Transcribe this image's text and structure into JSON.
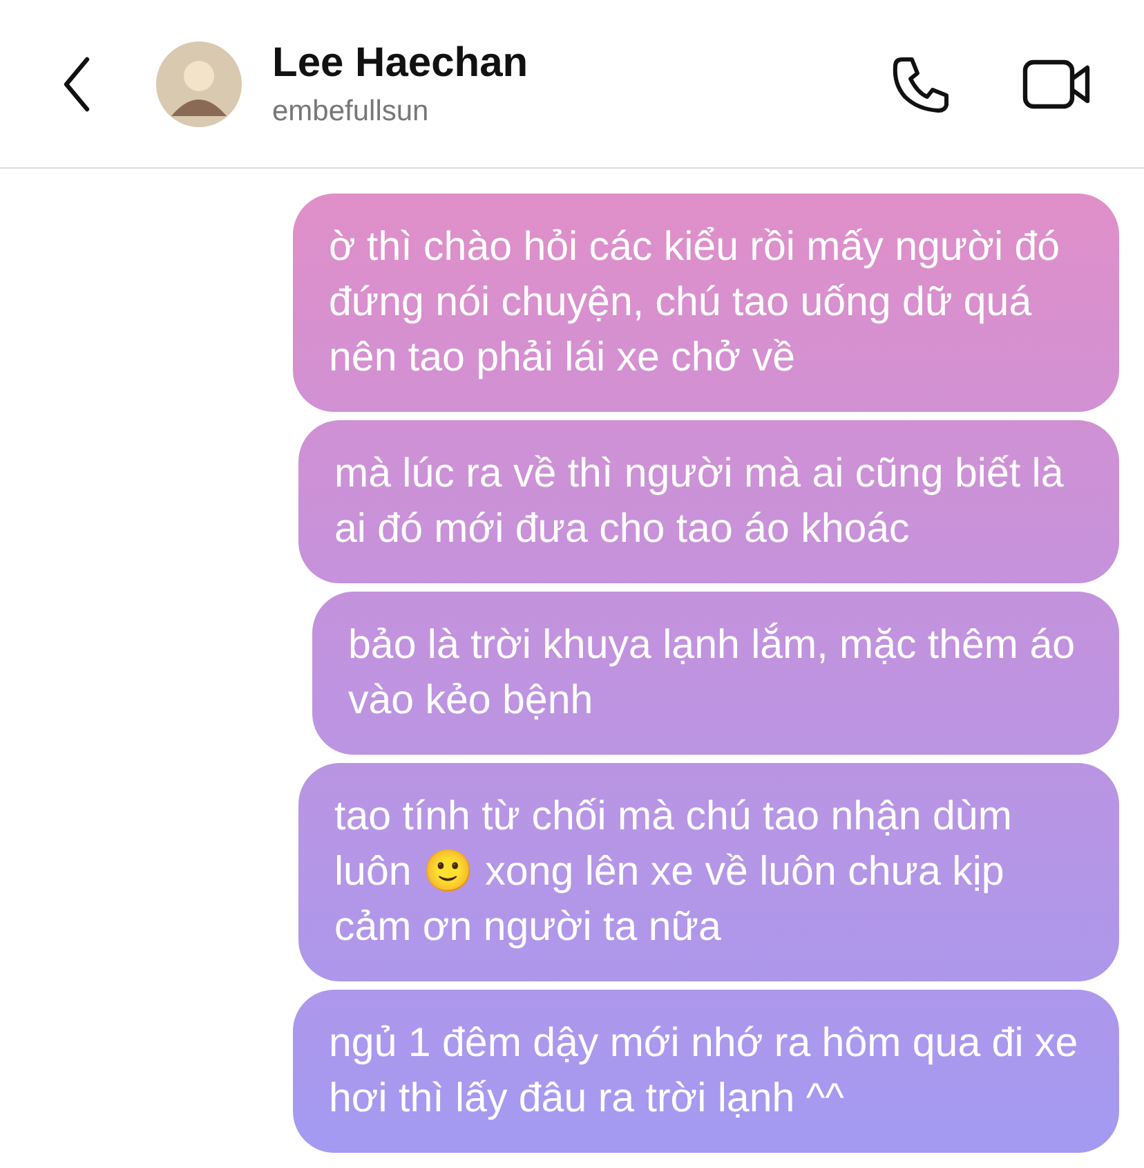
{
  "header": {
    "name": "Lee Haechan",
    "username": "embefullsun"
  },
  "messages": [
    {
      "text": "ờ thì chào hỏi các kiểu rồi mấy người đó đứng nói chuyện, chú tao uống dữ quá nên tao phải lái xe chở về"
    },
    {
      "text": "mà lúc ra về thì người mà ai cũng biết là ai đó mới đưa cho tao áo khoác"
    },
    {
      "text": "bảo là trời khuya lạnh lắm, mặc thêm áo vào kẻo bệnh"
    },
    {
      "text": "tao tính từ chối mà chú tao nhận dùm luôn 🙂 xong lên xe về luôn chưa kịp cảm ơn người ta nữa"
    },
    {
      "text": "ngủ 1 đêm dậy mới nhớ ra hôm qua đi xe hơi thì lấy đâu ra trời lạnh ^^"
    }
  ]
}
